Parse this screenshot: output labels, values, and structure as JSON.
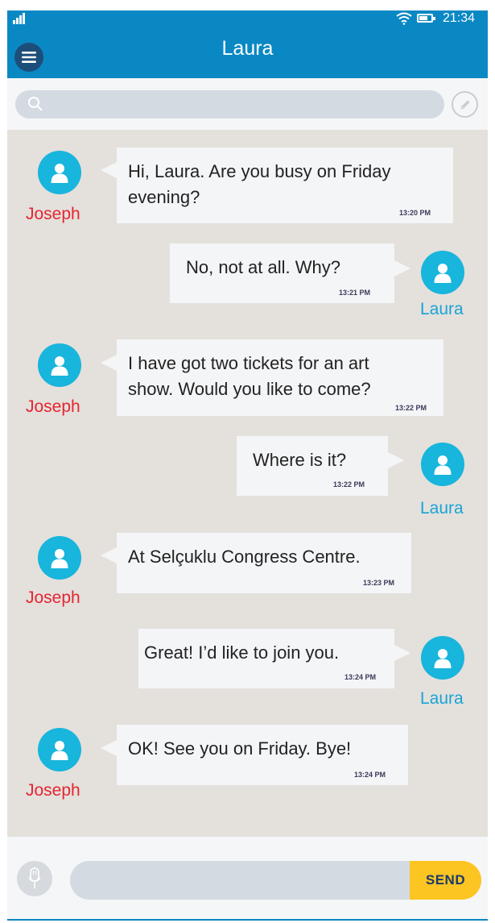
{
  "status_bar": {
    "time": "21:34",
    "icons": [
      "signal-icon",
      "wifi-icon",
      "battery-icon"
    ]
  },
  "header": {
    "title": "Laura",
    "menu_icon": "hamburger-menu-icon"
  },
  "search": {
    "placeholder": "",
    "icon": "search-icon",
    "compose_icon": "pencil-icon"
  },
  "messages": [
    {
      "sender": "Joseph",
      "side": "left",
      "lines": [
        "Hi, Laura. Are you busy on Friday",
        "evening?"
      ],
      "time": "13:20 PM"
    },
    {
      "sender": "Laura",
      "side": "right",
      "lines": [
        "No, not at all. Why?"
      ],
      "time": "13:21 PM"
    },
    {
      "sender": "Joseph",
      "side": "left",
      "lines": [
        "I have got two tickets for an art",
        "show. Would you like to come?"
      ],
      "time": "13:22 PM"
    },
    {
      "sender": "Laura",
      "side": "right",
      "lines": [
        "Where is it?"
      ],
      "time": "13:22 PM"
    },
    {
      "sender": "Joseph",
      "side": "left",
      "lines": [
        "At Selçuklu Congress Centre."
      ],
      "time": "13:23 PM"
    },
    {
      "sender": "Laura",
      "side": "right",
      "lines": [
        "Great! I’d like to join you."
      ],
      "time": "13:24 PM"
    },
    {
      "sender": "Joseph",
      "side": "left",
      "lines": [
        "OK! See you on Friday. Bye!"
      ],
      "time": "13:24 PM"
    }
  ],
  "composer": {
    "placeholder": "",
    "send_label": "SEND",
    "mic_icon": "microphone-icon"
  },
  "colors": {
    "header": "#0a88c4",
    "avatar": "#18b5dc",
    "joseph_name": "#e52431",
    "laura_name": "#19a4d7",
    "send_button": "#fcc521",
    "background": "#e4e0dc"
  }
}
